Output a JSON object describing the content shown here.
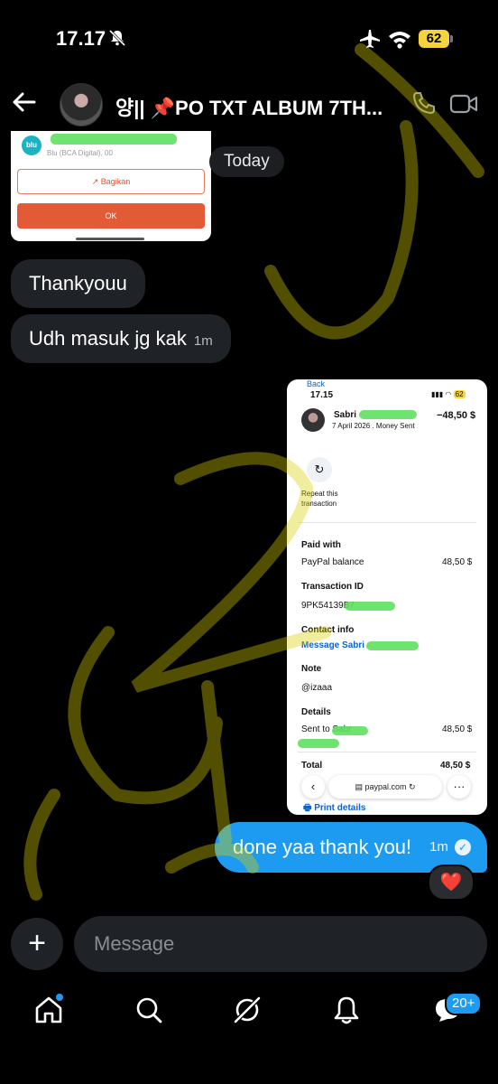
{
  "status_bar": {
    "time": "17.17",
    "battery": "62"
  },
  "header": {
    "title": "양|| 📌PO TXT ALBUM 7TH..."
  },
  "messages": {
    "date_divider": "Today",
    "incoming": [
      {
        "text": "Thankyouu"
      },
      {
        "text": "Udh masuk jg kak",
        "time": "1m"
      }
    ],
    "outgoing": {
      "text": "done yaa thank you!",
      "time": "1m",
      "reaction": "❤️"
    }
  },
  "transfer_screenshot": {
    "logo": "blu",
    "bank_line": "Blu (BCA Digital), 00",
    "share_label": "Bagikan",
    "ok_label": "OK"
  },
  "paypal_screenshot": {
    "back": "Back",
    "time": "17.15",
    "battery": "62",
    "name": "Sabri",
    "date_line": "7 April 2026 . Money Sent",
    "amount": "−48,50 $",
    "repeat_label": "Repeat this transaction",
    "paid_with_label": "Paid with",
    "paid_with_value": "PayPal balance",
    "paid_with_amount": "48,50 $",
    "transaction_id_label": "Transaction ID",
    "transaction_id_value": "9PK54139B7",
    "contact_label": "Contact info",
    "contact_value": "Message Sabri",
    "note_label": "Note",
    "note_value": "@izaaa",
    "details_label": "Details",
    "sent_to": "Sent to Sabr",
    "sent_amount": "48,50 $",
    "total_label": "Total",
    "total_amount": "48,50 $",
    "url": "paypal.com",
    "print_label": "Print details"
  },
  "composer": {
    "placeholder": "Message"
  },
  "bottom_nav": {
    "messages_badge": "20+"
  },
  "watermark_text": "izaa",
  "colors": {
    "accent": "#1d9bf0",
    "bubble_incoming": "#1f2226",
    "watermark": "#d8d000",
    "ok_button": "#e25a36"
  }
}
